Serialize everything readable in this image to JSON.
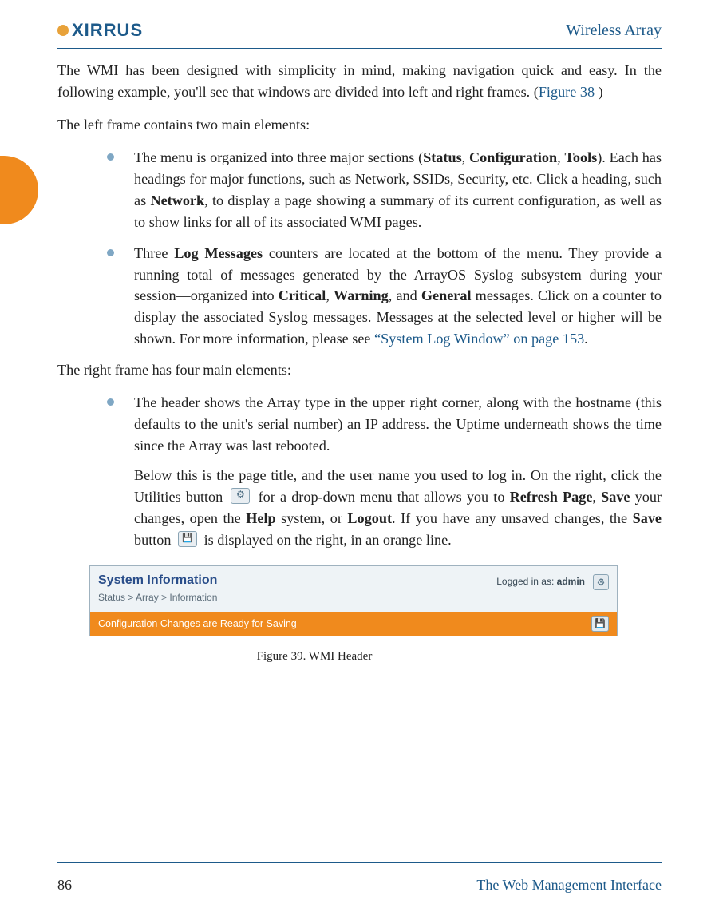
{
  "header": {
    "logo_text": "XIRRUS",
    "product": "Wireless Array"
  },
  "para1_pre": "The WMI has been designed with simplicity in mind, making navigation quick and easy. In the following example, you'll see that windows are divided into left and right frames. (",
  "para1_link": "Figure 38",
  "para1_post": " )",
  "para2": "The left frame contains two main elements:",
  "bullets_left": {
    "b1": {
      "pre": "The menu is organized into three major sections (",
      "s1": "Status",
      "mid1": ", ",
      "s2": "Configuration",
      "mid2": ", ",
      "s3": "Tools",
      "post1": "). Each has headings for major functions, such as Network, SSIDs, Security, etc. Click a heading, such as ",
      "s4": "Network",
      "post2": ", to display a page showing a summary of its current configuration, as well as to show links for all of its associated WMI pages."
    },
    "b2": {
      "pre": "Three ",
      "s1": "Log Messages",
      "mid1": " counters are located at the bottom of the menu. They provide a running total of messages generated by the ArrayOS Syslog subsystem during your session—organized into ",
      "s2": "Critical",
      "mid2": ", ",
      "s3": "Warning",
      "mid3": ", and ",
      "s4": "General",
      "post1": " messages. Click on a counter to display the associated Syslog messages. Messages at the selected level or higher will be shown. For more information, please see ",
      "link": "“System Log Window” on page 153",
      "post2": "."
    }
  },
  "para3": "The right frame has four main elements:",
  "bullets_right": {
    "b1_p1": "The header shows the Array type in the upper right corner, along with the hostname (this defaults to the unit's serial number) an IP address. the Uptime underneath shows the time since the Array was last rebooted.",
    "b1_p2": {
      "pre": "Below this is the page title, and the user name you used to log in. On the right, click the Utilities button ",
      "mid1": " for a drop-down menu that allows you to ",
      "s1": "Refresh Page",
      "mid2": ", ",
      "s2": "Save",
      "mid3": " your changes, open the ",
      "s3": "Help",
      "mid4": " system, or ",
      "s4": "Logout",
      "mid5": ". If you have any unsaved changes, the ",
      "s5": "Save",
      "mid6": " button ",
      "post": " is displayed on the right, in an orange line."
    }
  },
  "figure": {
    "title": "System Information",
    "breadcrumb": "Status > Array > Information",
    "login_pre": "Logged in as: ",
    "login_user": "admin",
    "orange_msg": "Configuration Changes are Ready for Saving",
    "caption": "Figure 39. WMI Header"
  },
  "footer": {
    "page": "86",
    "section": "The Web Management Interface"
  }
}
